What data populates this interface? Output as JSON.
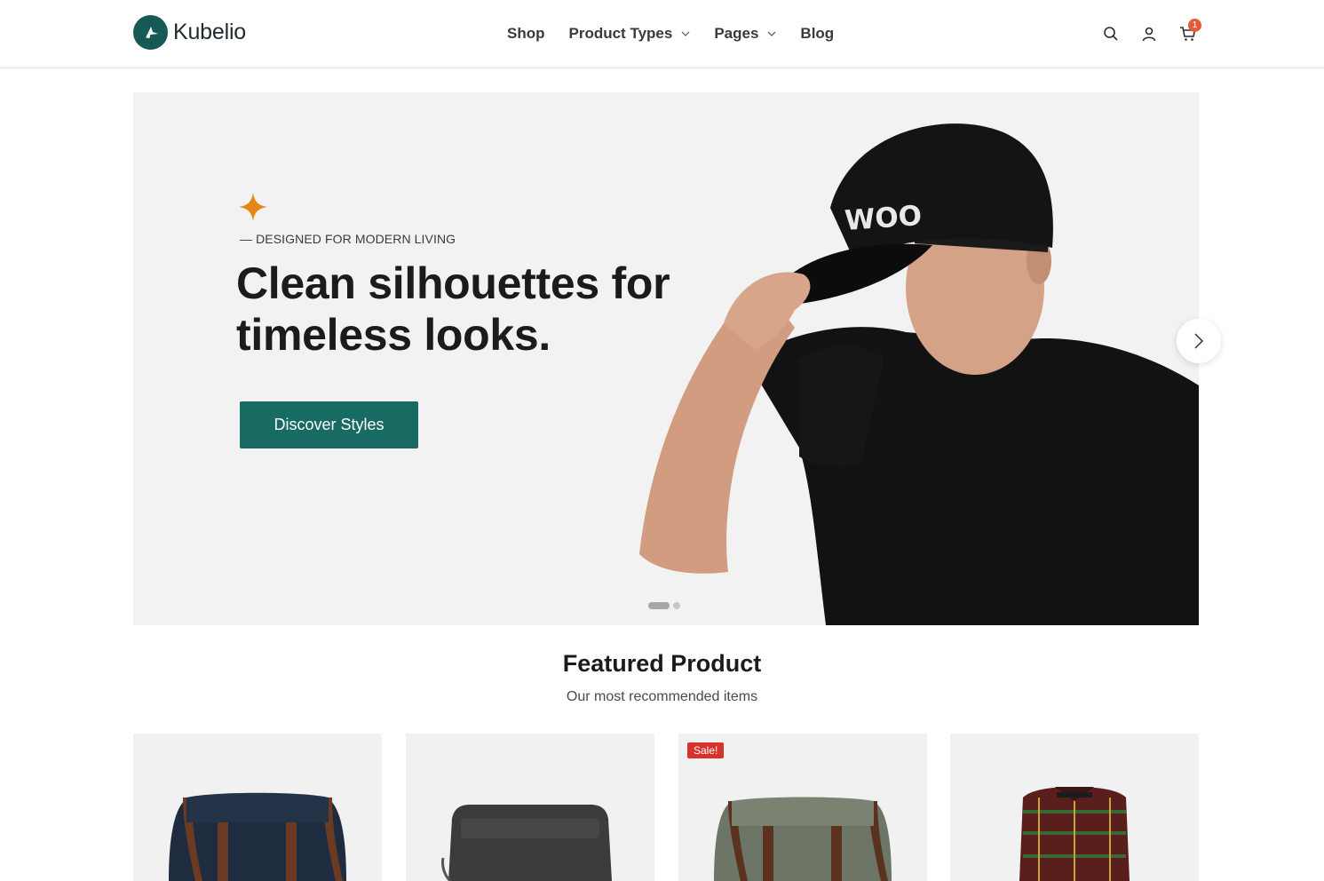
{
  "brand": {
    "name": "Kubelio",
    "color": "#175a55"
  },
  "nav": [
    {
      "label": "Shop",
      "has_dropdown": false
    },
    {
      "label": "Product Types",
      "has_dropdown": true
    },
    {
      "label": "Pages",
      "has_dropdown": true
    },
    {
      "label": "Blog",
      "has_dropdown": false
    }
  ],
  "header_icons": [
    "search-icon",
    "account-icon",
    "cart-icon"
  ],
  "cart": {
    "count": "1"
  },
  "hero": {
    "eyebrow": "— DESIGNED FOR MODERN LIVING",
    "title": "Clean silhouettes for timeless looks.",
    "cta": "Discover Styles",
    "cap_text": "WOO",
    "accent": "#e8851a",
    "slides": {
      "total": 2,
      "active": 1
    }
  },
  "featured": {
    "title": "Featured Product",
    "subtitle": "Our most recommended items"
  },
  "products": [
    {
      "name": "navy-messenger-bag",
      "badge": "",
      "color": "#1f2b3f"
    },
    {
      "name": "grey-crossbody-pouch",
      "badge": "",
      "color": "#3b3b3b"
    },
    {
      "name": "olive-messenger-bag",
      "badge": "Sale!",
      "color": "#6d7566"
    },
    {
      "name": "plaid-flannel-shirt",
      "badge": "",
      "color": "#5a1f1d"
    }
  ]
}
